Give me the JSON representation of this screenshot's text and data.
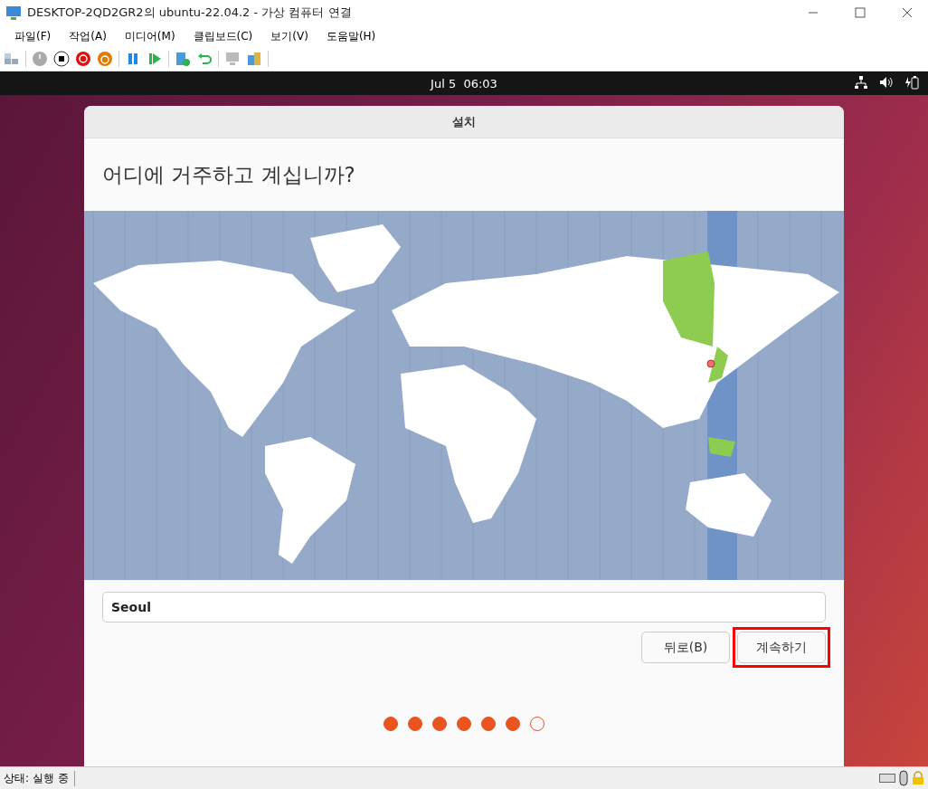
{
  "window": {
    "title": "DESKTOP-2QD2GR2의 ubuntu-22.04.2 - 가상 컴퓨터 연결"
  },
  "menu": [
    "파일(F)",
    "작업(A)",
    "미디어(M)",
    "클립보드(C)",
    "보기(V)",
    "도움말(H)"
  ],
  "top_panel": {
    "clock": "Jul 5  06:03"
  },
  "installer": {
    "title": "설치",
    "heading": "어디에 거주하고 계십니까?",
    "location": {
      "value": "Seoul"
    },
    "buttons": [
      {
        "label": "뒤로(B)",
        "highlighted": false
      },
      {
        "label": "계속하기",
        "highlighted": true
      }
    ],
    "steps": [
      {
        "filled": true
      },
      {
        "filled": true
      },
      {
        "filled": true
      },
      {
        "filled": true
      },
      {
        "filled": true
      },
      {
        "filled": true
      },
      {
        "filled": false
      }
    ]
  },
  "status_bar": {
    "text": "상태: 실행 중"
  }
}
